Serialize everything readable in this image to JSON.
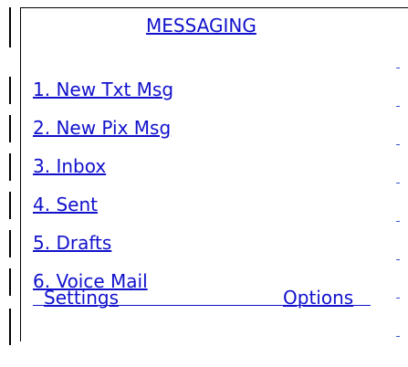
{
  "screen": {
    "title": "MESSAGING"
  },
  "menu": {
    "items": [
      {
        "label": "1. New Txt Msg"
      },
      {
        "label": "2. New Pix Msg"
      },
      {
        "label": "3. Inbox"
      },
      {
        "label": "4. Sent"
      },
      {
        "label": "5. Drafts"
      },
      {
        "label": "6. Voice Mail"
      }
    ]
  },
  "softkeys": {
    "left": "Settings",
    "right": "Options"
  },
  "colors": {
    "link": "#1111cc",
    "banner": "#ff0000",
    "border": "#000000"
  }
}
